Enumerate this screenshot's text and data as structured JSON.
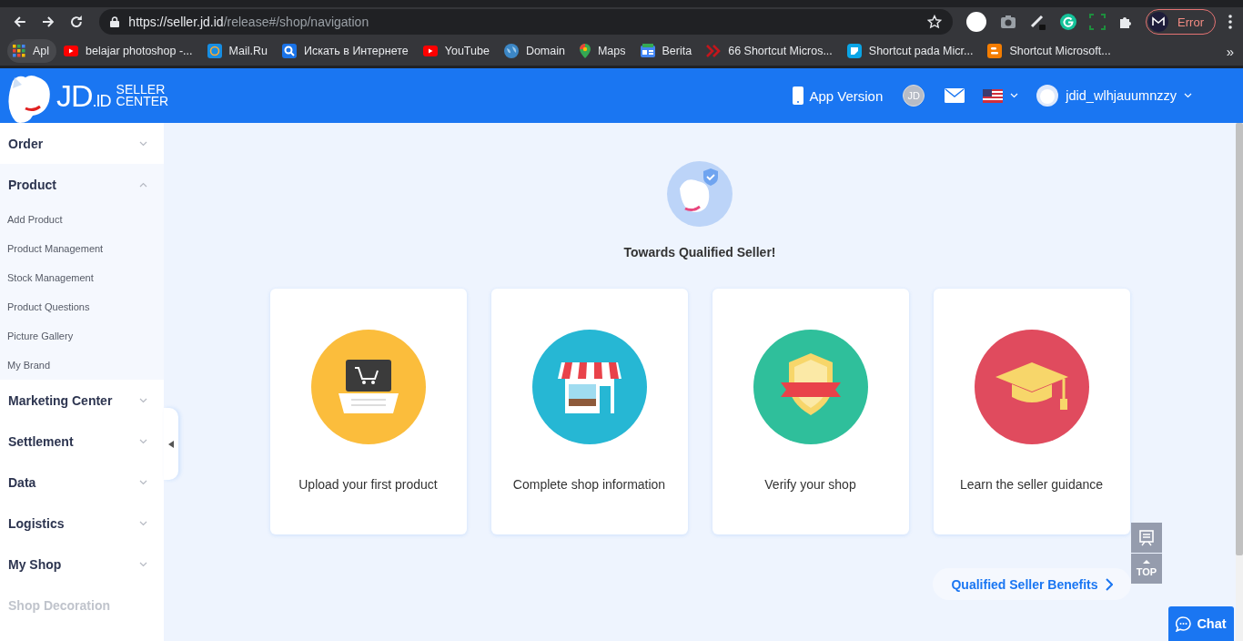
{
  "browser": {
    "address": {
      "host": "https://seller.jd.id",
      "path": "/release#/shop/navigation"
    },
    "extension_badge": "Error",
    "bookmarks": [
      {
        "kind": "apps",
        "label": "Apl"
      },
      {
        "kind": "video",
        "label": "belajar photoshop -..."
      },
      {
        "kind": "mail",
        "label": "Mail.Ru"
      },
      {
        "kind": "search",
        "label": "Искать в Интернете"
      },
      {
        "kind": "video",
        "label": "YouTube"
      },
      {
        "kind": "globe",
        "label": "Domain"
      },
      {
        "kind": "pin",
        "label": "Maps"
      },
      {
        "kind": "news",
        "label": "Berita"
      },
      {
        "kind": "chevrons",
        "label": "66 Shortcut Micros..."
      },
      {
        "kind": "square",
        "label": "Shortcut pada Micr..."
      },
      {
        "kind": "blog",
        "label": "Shortcut Microsoft..."
      }
    ],
    "more": "»"
  },
  "header": {
    "logo": {
      "brand": "JD",
      "suffix": ".ID",
      "line_1": "SELLER",
      "line_2": "CENTER"
    },
    "app_version": "App Version",
    "badge": "JD",
    "username": "jdid_wlhjauumnzzy"
  },
  "sidebar": {
    "items": [
      {
        "label": "Order",
        "expanded": false,
        "disabled": false
      },
      {
        "label": "Product",
        "expanded": true,
        "disabled": false,
        "children": [
          {
            "label": "Add Product"
          },
          {
            "label": "Product Management"
          },
          {
            "label": "Stock Management"
          },
          {
            "label": "Product Questions"
          },
          {
            "label": "Picture Gallery"
          },
          {
            "label": "My Brand"
          }
        ]
      },
      {
        "label": "Marketing Center",
        "expanded": false,
        "disabled": false
      },
      {
        "label": "Settlement",
        "expanded": false,
        "disabled": false
      },
      {
        "label": "Data",
        "expanded": false,
        "disabled": false
      },
      {
        "label": "Logistics",
        "expanded": false,
        "disabled": false
      },
      {
        "label": "My Shop",
        "expanded": false,
        "disabled": false
      },
      {
        "label": "Shop Decoration",
        "expanded": false,
        "disabled": true
      }
    ]
  },
  "main": {
    "title": "Towards Qualified Seller!",
    "cards": [
      {
        "kind": "laptop",
        "color": "#fbbd3c",
        "label": "Upload your first product"
      },
      {
        "kind": "shop",
        "color": "#26b7d4",
        "label": "Complete shop information"
      },
      {
        "kind": "badge",
        "color": "#2fbf9b",
        "label": "Verify your shop"
      },
      {
        "kind": "cap",
        "color": "#e04b5e",
        "label": "Learn the seller guidance"
      }
    ],
    "benefits_link": "Qualified Seller Benefits",
    "top_button": "TOP",
    "chat_button": "Chat"
  }
}
